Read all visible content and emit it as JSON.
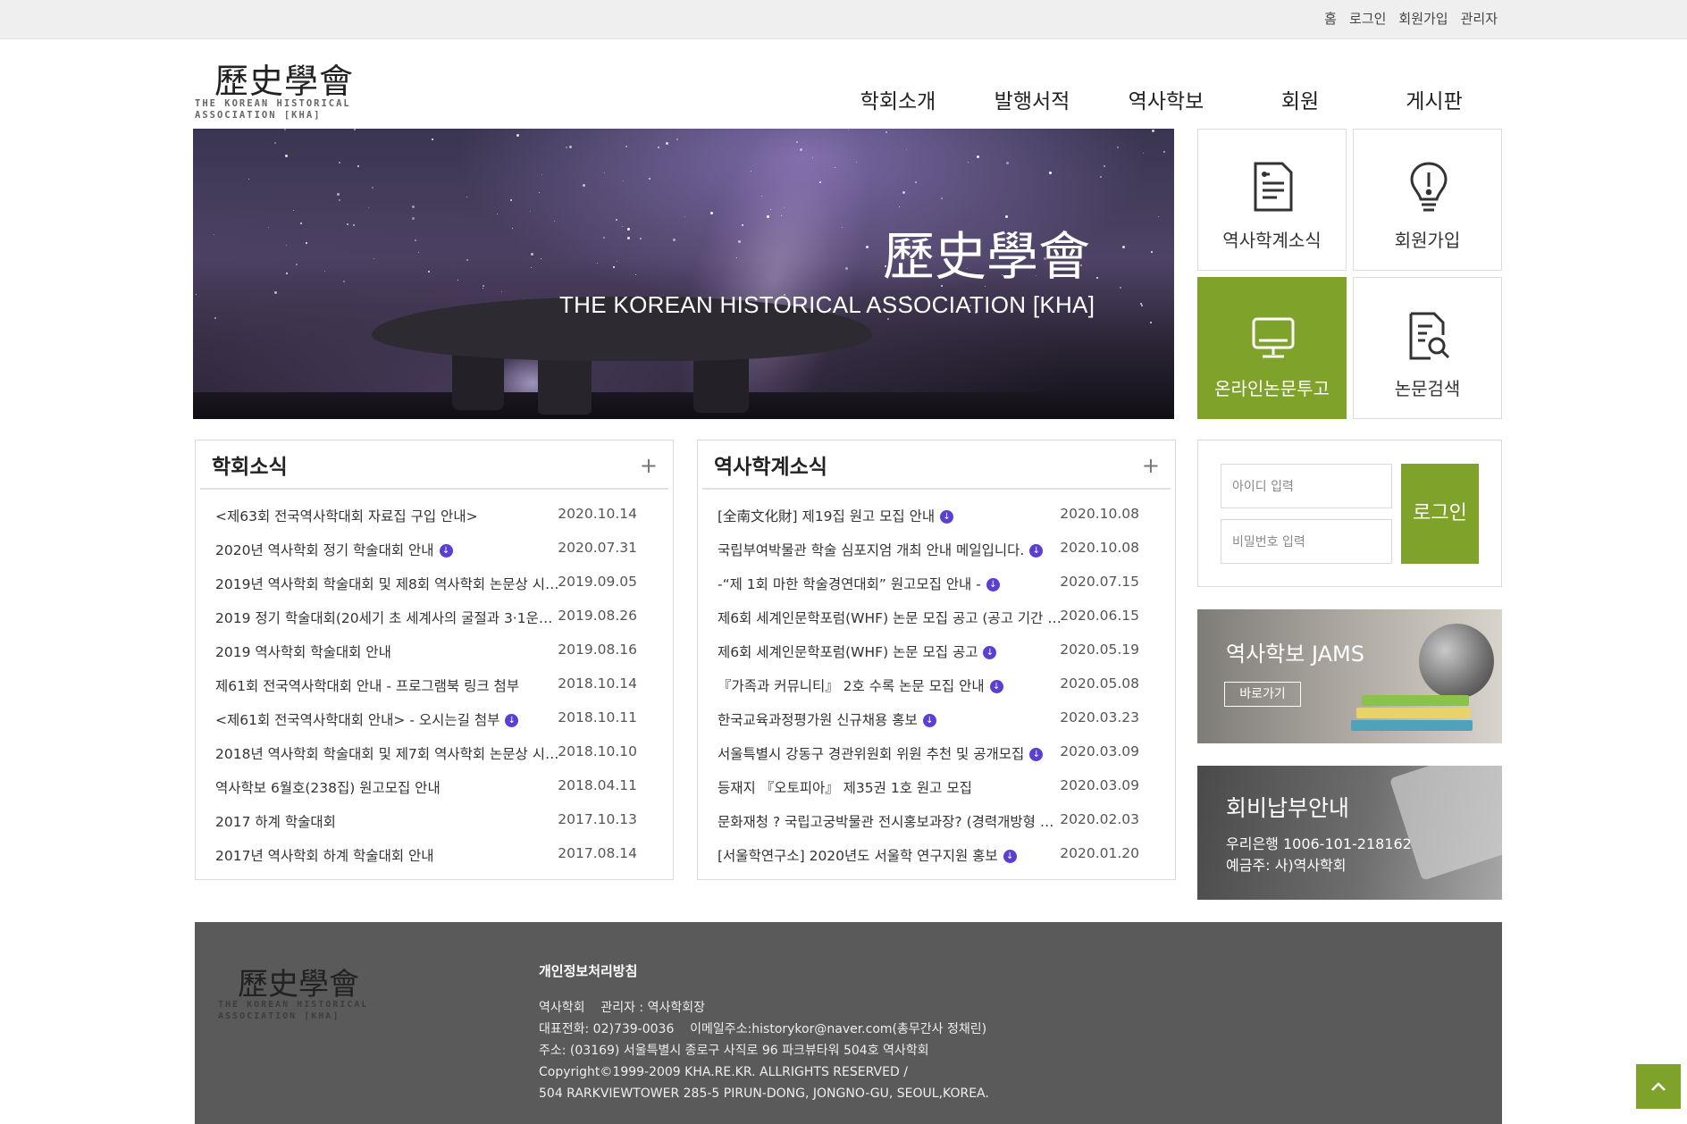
{
  "utility_nav": [
    "홈",
    "로그인",
    "회원가입",
    "관리자"
  ],
  "logo": {
    "hanja": "歷史學會",
    "eng_line1": "THE KOREAN HISTORICAL",
    "eng_line2": "ASSOCIATION [KHA]"
  },
  "main_nav": [
    "학회소개",
    "발행서적",
    "역사학보",
    "회원",
    "게시판"
  ],
  "hero": {
    "title": "歷史學會",
    "subtitle": "THE KOREAN HISTORICAL ASSOCIATION [KHA]"
  },
  "quick_tiles": [
    {
      "label": "역사학계소식",
      "icon": "document-list-icon"
    },
    {
      "label": "회원가입",
      "icon": "lightbulb-icon"
    },
    {
      "label": "온라인논문투고",
      "icon": "monitor-icon"
    },
    {
      "label": "논문검색",
      "icon": "document-search-icon"
    }
  ],
  "board_society": {
    "title": "학회소식",
    "more": "+",
    "items": [
      {
        "title": "<제63회 전국역사학대회 자료집 구입 안내>",
        "date": "2020.10.14",
        "attachment": false
      },
      {
        "title": "2020년 역사학회 정기 학술대회 안내",
        "date": "2020.07.31",
        "attachment": true
      },
      {
        "title": "2019년 역사학회 학술대회 및 제8회 역사학회 논문상 시…",
        "date": "2019.09.05",
        "attachment": false
      },
      {
        "title": "2019 정기 학술대회(20세기 초 세계사의 굴절과 3·1운동…",
        "date": "2019.08.26",
        "attachment": false
      },
      {
        "title": "2019 역사학회 학술대회 안내",
        "date": "2019.08.16",
        "attachment": false
      },
      {
        "title": "제61회 전국역사학대회 안내 - 프로그램북 링크 첨부",
        "date": "2018.10.14",
        "attachment": false
      },
      {
        "title": "<제61회 전국역사학대회 안내> - 오시는길 첨부",
        "date": "2018.10.11",
        "attachment": true
      },
      {
        "title": "2018년 역사학회 학술대회 및 제7회 역사학회 논문상 시…",
        "date": "2018.10.10",
        "attachment": false
      },
      {
        "title": "역사학보 6월호(238집) 원고모집 안내",
        "date": "2018.04.11",
        "attachment": false
      },
      {
        "title": "2017 하계 학술대회",
        "date": "2017.10.13",
        "attachment": false
      },
      {
        "title": "2017년 역사학회 하계 학술대회 안내",
        "date": "2017.08.14",
        "attachment": false
      }
    ]
  },
  "board_field": {
    "title": "역사학계소식",
    "more": "+",
    "items": [
      {
        "title": "[全南文化財] 제19집 원고 모집 안내",
        "date": "2020.10.08",
        "attachment": true
      },
      {
        "title": "국립부여박물관 학술 심포지엄 개최 안내 메일입니다.",
        "date": "2020.10.08",
        "attachment": true
      },
      {
        "title": "-“제 1회 마한 학술경연대회” 원고모집 안내 -",
        "date": "2020.07.15",
        "attachment": true
      },
      {
        "title": "제6회 세계인문학포럼(WHF) 논문 모집 공고 (공고 기간 …",
        "date": "2020.06.15",
        "attachment": false
      },
      {
        "title": "제6회 세계인문학포럼(WHF) 논문 모집 공고",
        "date": "2020.05.19",
        "attachment": true
      },
      {
        "title": "『가족과 커뮤니티』 2호 수록 논문 모집 안내",
        "date": "2020.05.08",
        "attachment": true
      },
      {
        "title": "한국교육과정평가원 신규채용 홍보",
        "date": "2020.03.23",
        "attachment": true
      },
      {
        "title": "서울특별시 강동구 경관위원회 위원 추천 및 공개모집",
        "date": "2020.03.09",
        "attachment": true
      },
      {
        "title": "등재지 『오토피아』 제35권 1호 원고 모집",
        "date": "2020.03.09",
        "attachment": false
      },
      {
        "title": "문화재청 ? 국립고궁박물관 전시홍보과장? (경력개방형 …",
        "date": "2020.02.03",
        "attachment": false
      },
      {
        "title": "[서울학연구소] 2020년도 서울학 연구지원 홍보",
        "date": "2020.01.20",
        "attachment": true
      }
    ]
  },
  "login": {
    "id_placeholder": "아이디 입력",
    "pw_placeholder": "비밀번호 입력",
    "button": "로그인"
  },
  "jams_banner": {
    "title": "역사학보 JAMS",
    "button": "바로가기"
  },
  "fee_banner": {
    "title": "회비납부안내",
    "account": "우리은행 1006-101-218162",
    "holder": "예금주: 사)역사학회"
  },
  "footer": {
    "privacy": "개인정보처리방침",
    "line1": "역사학회    관리자 : 역사학회장",
    "line2": "대표전화: 02)739-0036    이메일주소:historykor@naver.com(총무간사 정채린)",
    "line3": "주소: (03169) 서울특별시 종로구 사직로 96 파크뷰타워 504호 역사학회",
    "line4": "Copyright©1999-2009 KHA.RE.KR. ALLRIGHTS RESERVED /",
    "line5": "504 RARKVIEWTOWER 285-5 PIRUN-DONG, JONGNO-GU, SEOUL,KOREA."
  },
  "colors": {
    "accent": "#7fa22b",
    "footer_bg": "#5a5a5a",
    "attachment_icon": "#5b3fd1"
  }
}
